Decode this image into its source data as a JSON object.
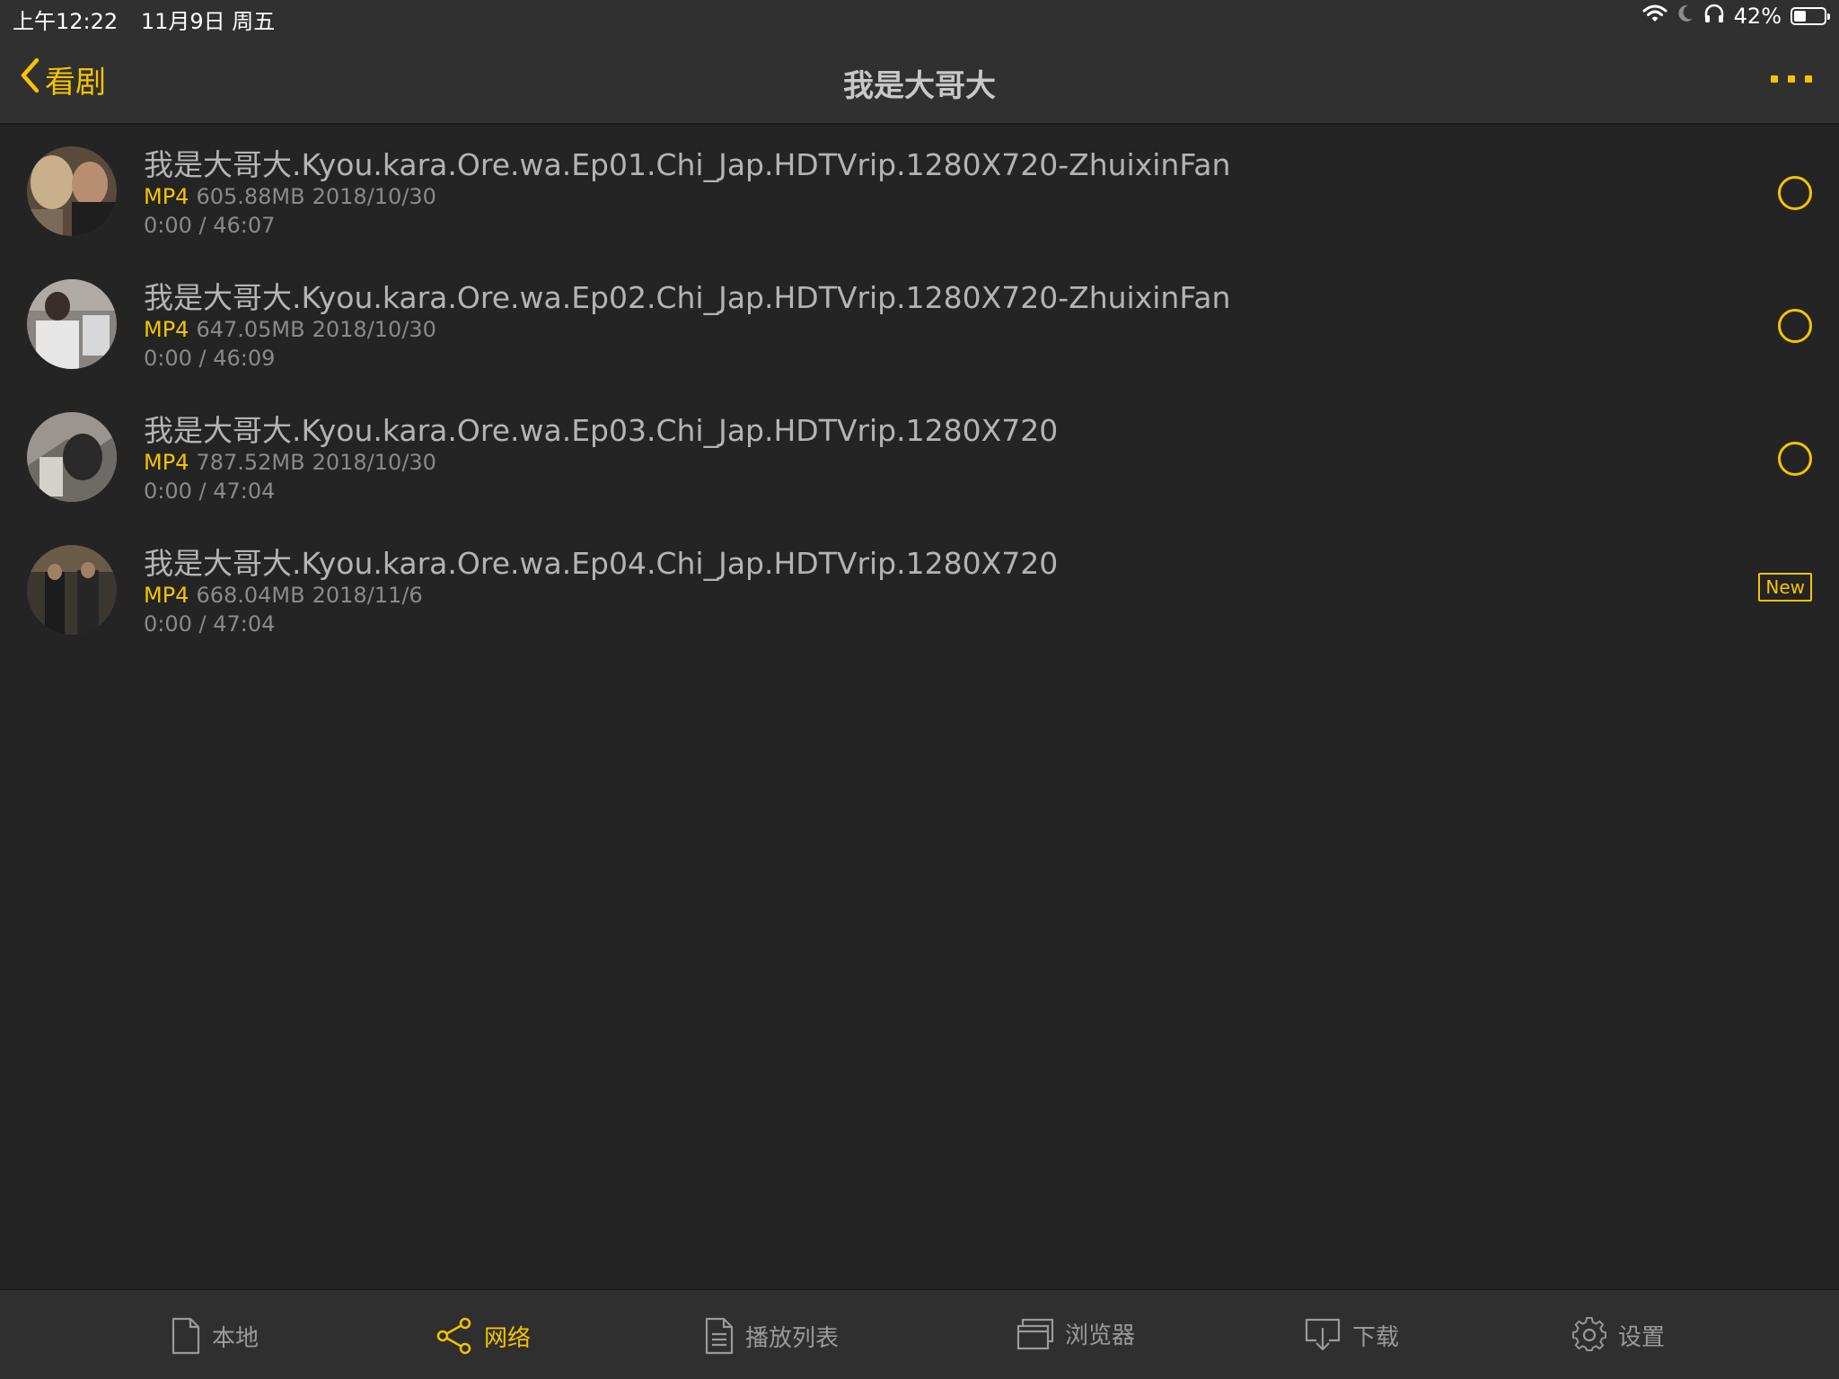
{
  "status_bar": {
    "time": "上午12:22",
    "date": "11月9日 周五",
    "battery_percent": "42%",
    "battery_level": 0.42
  },
  "nav": {
    "back_label": "看剧",
    "title": "我是大哥大"
  },
  "colors": {
    "accent": "#f5c400",
    "background": "#242424",
    "bar": "#303030"
  },
  "videos": [
    {
      "title": "我是大哥大.Kyou.kara.Ore.wa.Ep01.Chi_Jap.HDTVrip.1280X720-ZhuixinFan",
      "format": "MP4",
      "size": "605.88MB",
      "date": "2018/10/30",
      "progress": "0:00 / 46:07",
      "status": "circle"
    },
    {
      "title": "我是大哥大.Kyou.kara.Ore.wa.Ep02.Chi_Jap.HDTVrip.1280X720-ZhuixinFan",
      "format": "MP4",
      "size": "647.05MB",
      "date": "2018/10/30",
      "progress": "0:00 / 46:09",
      "status": "circle"
    },
    {
      "title": "我是大哥大.Kyou.kara.Ore.wa.Ep03.Chi_Jap.HDTVrip.1280X720",
      "format": "MP4",
      "size": "787.52MB",
      "date": "2018/10/30",
      "progress": "0:00 / 47:04",
      "status": "circle"
    },
    {
      "title": "我是大哥大.Kyou.kara.Ore.wa.Ep04.Chi_Jap.HDTVrip.1280X720",
      "format": "MP4",
      "size": "668.04MB",
      "date": "2018/11/6",
      "progress": "0:00 / 47:04",
      "status": "new",
      "badge": "New"
    }
  ],
  "tabs": [
    {
      "label": "本地",
      "icon": "file-icon"
    },
    {
      "label": "网络",
      "icon": "share-icon",
      "active": true
    },
    {
      "label": "播放列表",
      "icon": "document-list-icon"
    },
    {
      "label": "浏览器",
      "icon": "browser-window-icon"
    },
    {
      "label": "下载",
      "icon": "download-icon"
    },
    {
      "label": "设置",
      "icon": "gear-icon"
    }
  ]
}
